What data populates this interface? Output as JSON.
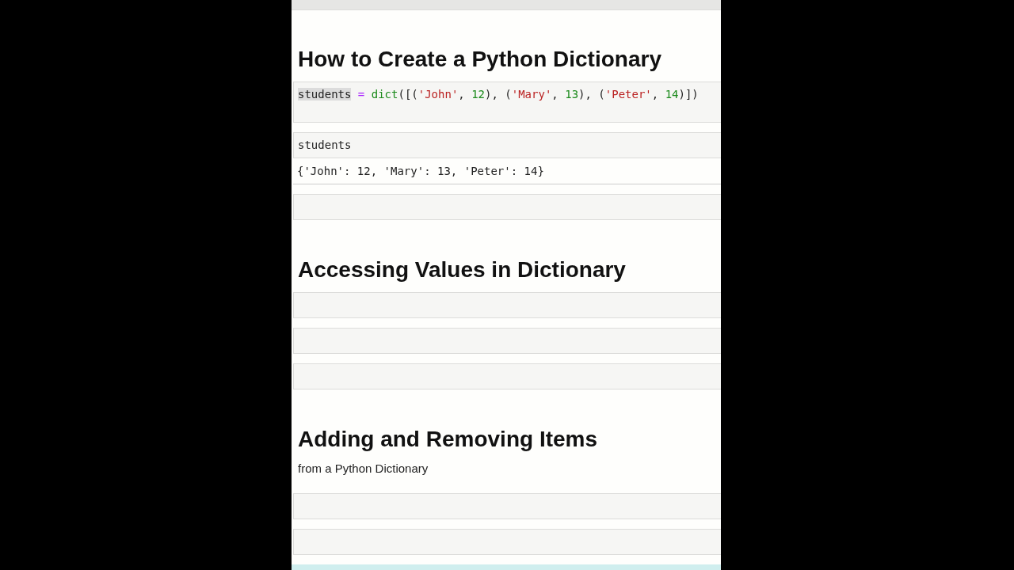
{
  "cells": [
    {
      "kind": "heading",
      "text": "How to Create a Python Dictionary"
    },
    {
      "kind": "code",
      "trailing_blank_line": true,
      "lines": [
        [
          {
            "text": "students",
            "highlighted": true
          },
          {
            "text": " = ",
            "color": "#aa22ff",
            "highlighted": false
          },
          {
            "text": "dict",
            "color": "#1a8a1a",
            "highlighted": false
          },
          {
            "text": "([(",
            "highlighted": false
          },
          {
            "text": "'John'",
            "color": "#ba2121",
            "highlighted": false
          },
          {
            "text": ", ",
            "highlighted": false
          },
          {
            "text": "12",
            "color": "#1a8a1a",
            "highlighted": false
          },
          {
            "text": "), (",
            "highlighted": false
          },
          {
            "text": "'Mary'",
            "color": "#ba2121",
            "highlighted": false
          },
          {
            "text": ", ",
            "highlighted": false
          },
          {
            "text": "13",
            "color": "#1a8a1a",
            "highlighted": false
          },
          {
            "text": "), (",
            "highlighted": false
          },
          {
            "text": "'Peter'",
            "color": "#ba2121",
            "highlighted": false
          },
          {
            "text": ", ",
            "highlighted": false
          },
          {
            "text": "14",
            "color": "#1a8a1a",
            "highlighted": false
          },
          {
            "text": ")])",
            "highlighted": false
          }
        ]
      ]
    },
    {
      "kind": "code",
      "trailing_blank_line": false,
      "lines": [
        [
          {
            "text": "students",
            "highlighted": false
          }
        ]
      ],
      "output": "{'John': 12, 'Mary': 13, 'Peter': 14}"
    },
    {
      "kind": "code",
      "trailing_blank_line": false
    },
    {
      "kind": "heading",
      "text": "Accessing Values in Dictionary"
    },
    {
      "kind": "code",
      "trailing_blank_line": false
    },
    {
      "kind": "code",
      "trailing_blank_line": false
    },
    {
      "kind": "code",
      "trailing_blank_line": false
    },
    {
      "kind": "heading",
      "text": "Adding and Removing Items"
    },
    {
      "kind": "text",
      "text": "from a Python Dictionary"
    },
    {
      "kind": "code",
      "trailing_blank_line": false
    },
    {
      "kind": "code",
      "trailing_blank_line": false
    }
  ]
}
